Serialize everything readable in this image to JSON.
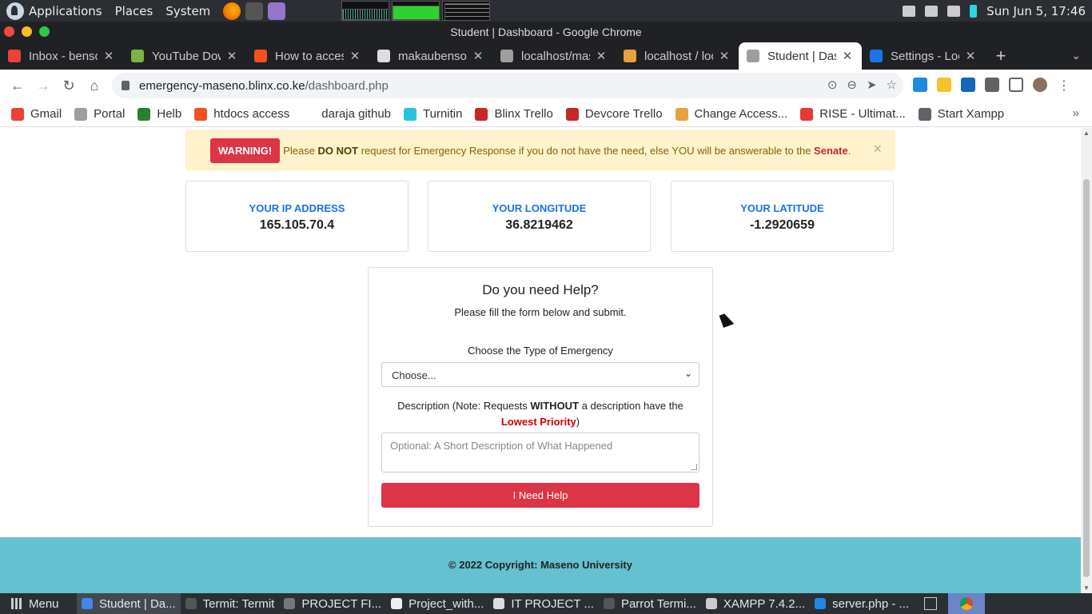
{
  "system_panel": {
    "menus": [
      "Applications",
      "Places",
      "System"
    ],
    "clock": "Sun Jun  5, 17:46"
  },
  "window": {
    "title": "Student | Dashboard - Google Chrome"
  },
  "tabs": [
    {
      "label": "Inbox - benso",
      "favicon_color": "#ea4335"
    },
    {
      "label": "YouTube Dow",
      "favicon_color": "#7cb342"
    },
    {
      "label": "How to access",
      "favicon_color": "#f4511e"
    },
    {
      "label": "makaubenson",
      "favicon_color": "#ddd"
    },
    {
      "label": "localhost/mas",
      "favicon_color": "#9e9e9e"
    },
    {
      "label": "localhost / loc",
      "favicon_color": "#e6a23c"
    },
    {
      "label": "Student | Das",
      "favicon_color": "#9e9e9e",
      "active": true
    },
    {
      "label": "Settings - Loc",
      "favicon_color": "#1a73e8"
    }
  ],
  "address": {
    "host": "emergency-maseno.blinx.co.ke",
    "path": "/dashboard.php"
  },
  "bookmarks": [
    {
      "label": "Gmail",
      "color": "#ea4335"
    },
    {
      "label": "Portal",
      "color": "#9e9e9e"
    },
    {
      "label": "Helb",
      "color": "#2e7d32"
    },
    {
      "label": "htdocs access",
      "color": "#f4511e"
    },
    {
      "label": "daraja github",
      "color": "#ffffff"
    },
    {
      "label": "Turnitin",
      "color": "#26c6da"
    },
    {
      "label": "Blinx Trello",
      "color": "#c62828"
    },
    {
      "label": "Devcore Trello",
      "color": "#c62828"
    },
    {
      "label": "Change Access...",
      "color": "#e6a23c"
    },
    {
      "label": "RISE - Ultimat...",
      "color": "#e53935"
    },
    {
      "label": "Start Xampp",
      "color": "#5f6368"
    }
  ],
  "alert": {
    "badge": "WARNING!",
    "text_1": "Please ",
    "bold_1": "DO NOT",
    "text_2": " request for Emergency Response if you do not have the need, else YOU will be answerable to the ",
    "senate": "Senate",
    "text_3": ".",
    "close": "×"
  },
  "cards": [
    {
      "label": "YOUR IP ADDRESS",
      "value": "165.105.70.4"
    },
    {
      "label": "YOUR LONGITUDE",
      "value": "36.8219462"
    },
    {
      "label": "YOUR LATITUDE",
      "value": "-1.2920659"
    }
  ],
  "form": {
    "title": "Do you need Help?",
    "subtitle": "Please fill the form below and submit.",
    "type_label": "Choose the Type of Emergency",
    "select_value": "Choose...",
    "desc_text_1": "Description (Note: Requests ",
    "desc_bold": "WITHOUT",
    "desc_text_2": " a description have the",
    "desc_lowest": "Lowest Priority",
    "desc_text_3": ")",
    "textarea_placeholder": "Optional: A Short Description of What Happened",
    "submit_label": "I Need Help"
  },
  "footer": {
    "copyright": "© 2022 Copyright: ",
    "org": "Maseno University"
  },
  "taskbar": {
    "menu_label": "Menu",
    "items": [
      {
        "label": "Student | Da...",
        "color": "#4285f4",
        "active": true
      },
      {
        "label": "Termit: Termit",
        "color": "#555"
      },
      {
        "label": "PROJECT FI...",
        "color": "#777"
      },
      {
        "label": "Project_with...",
        "color": "#eee"
      },
      {
        "label": "IT PROJECT ...",
        "color": "#ddd"
      },
      {
        "label": "Parrot Termi...",
        "color": "#555"
      },
      {
        "label": "XAMPP 7.4.2...",
        "color": "#ccc"
      },
      {
        "label": "server.php - ...",
        "color": "#1e88e5"
      }
    ]
  }
}
